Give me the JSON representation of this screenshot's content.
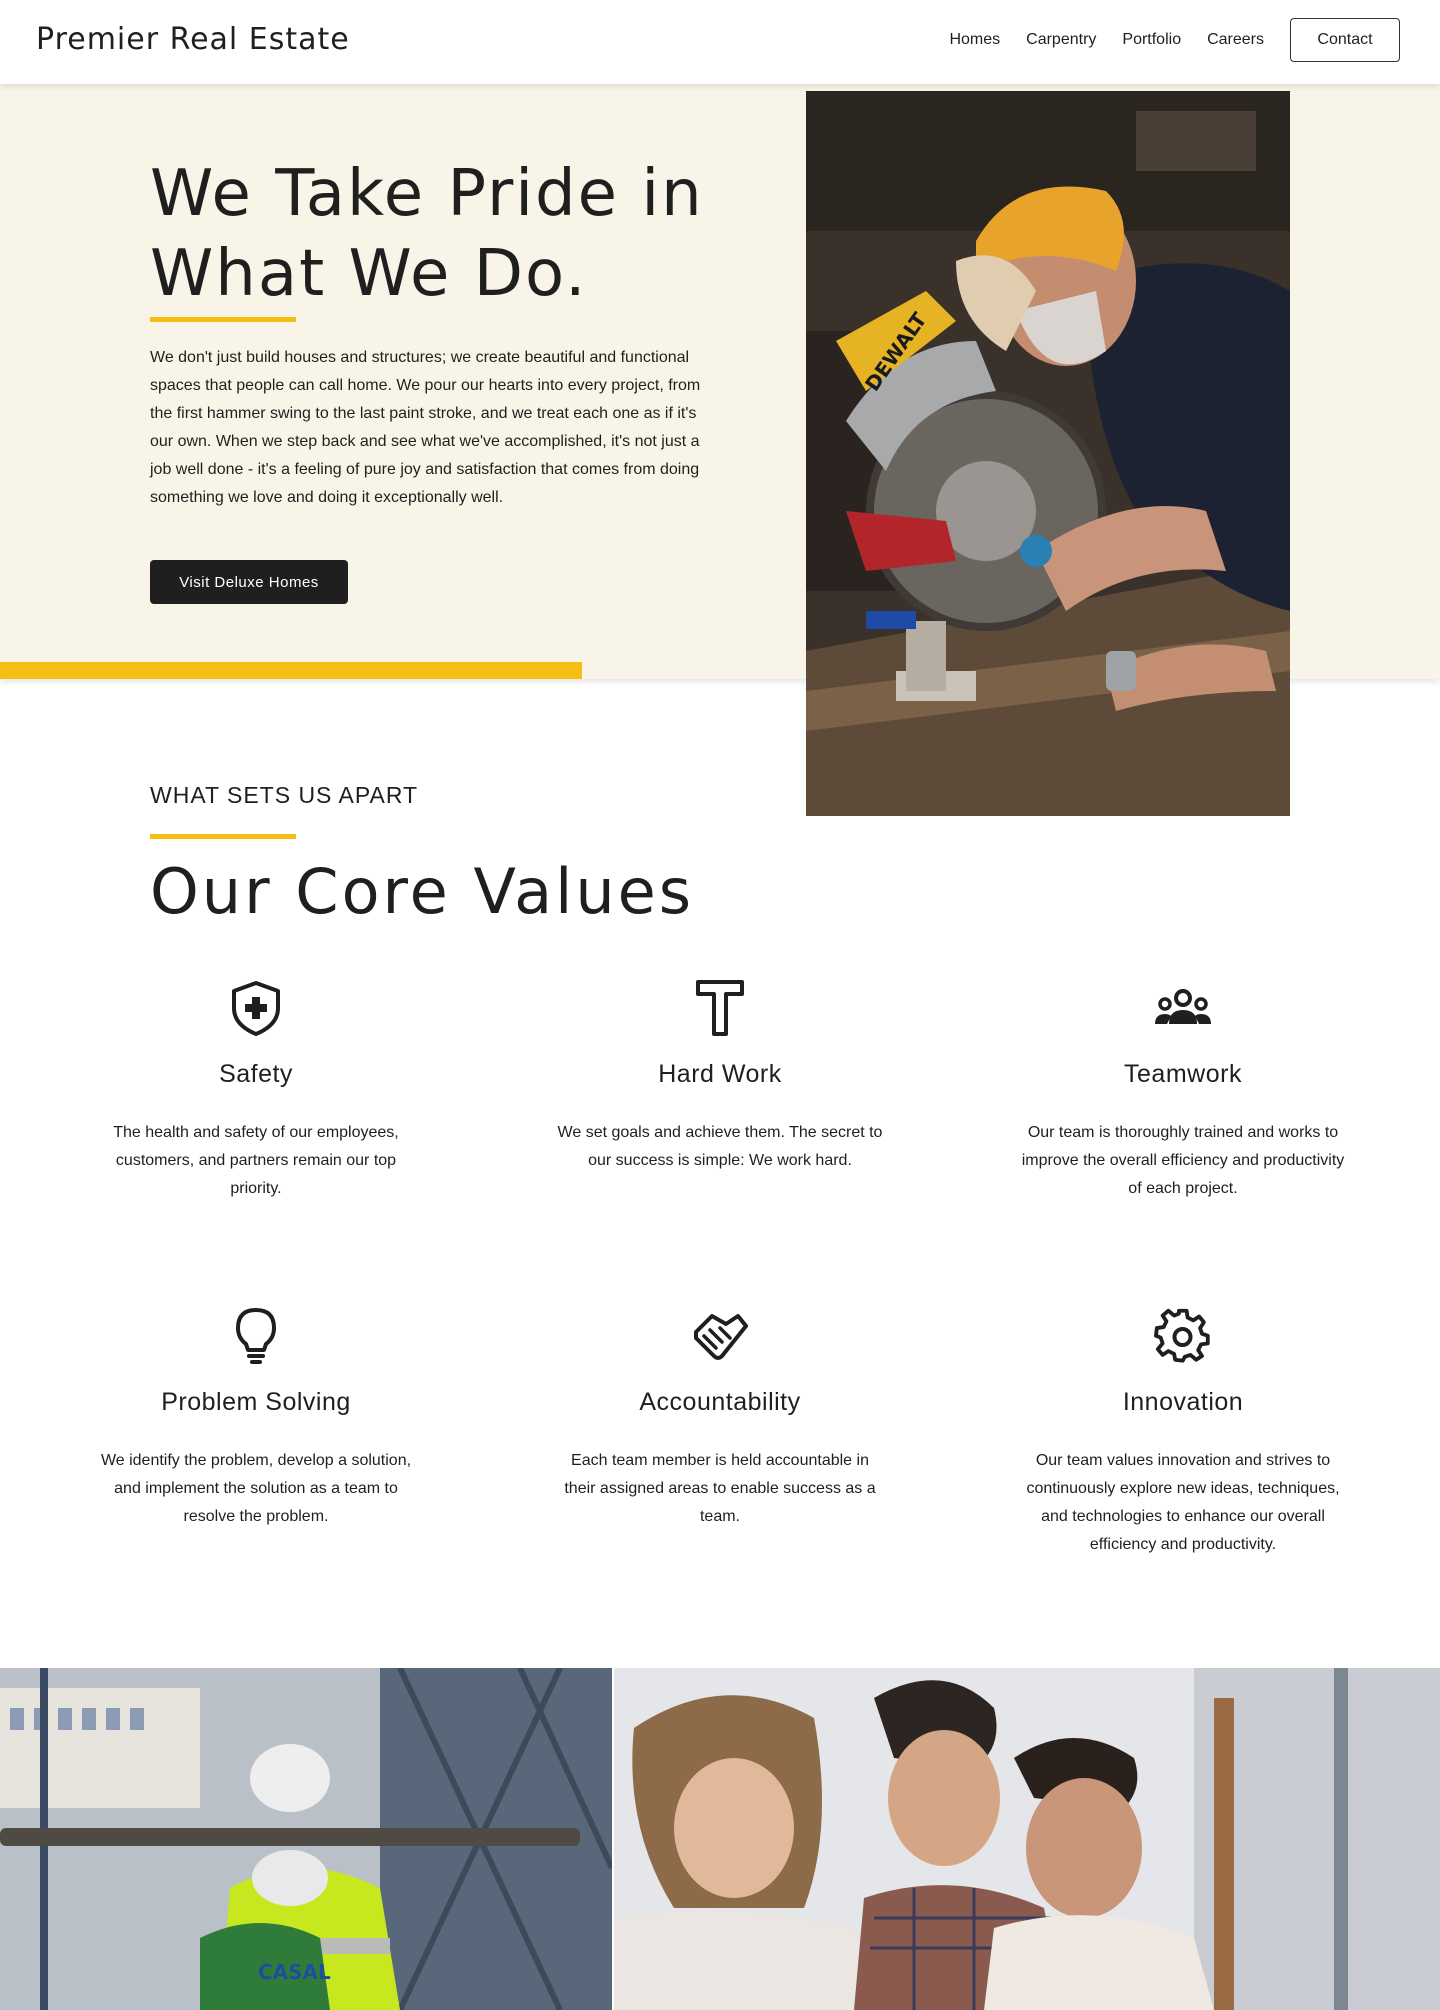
{
  "header": {
    "brand": "Premier Real Estate",
    "nav": [
      "Homes",
      "Carpentry",
      "Portfolio",
      "Careers"
    ],
    "contact_label": "Contact"
  },
  "hero": {
    "title_line1": "We Take Pride in",
    "title_line2": "What We Do.",
    "body": "We don't just build houses and structures; we create beautiful and functional spaces that people can call home. We pour our hearts into every project, from the first hammer swing to the last paint stroke, and we treat each one as if it's our own. When we step back and see what we've accomplished, it's not just a job well done - it's a feeling of pure joy and satisfaction that comes from doing something we love and doing it exceptionally well.",
    "button_label": "Visit Deluxe Homes",
    "photo_brand_text": "DEWALT"
  },
  "values_section": {
    "eyebrow": "WHAT SETS US APART",
    "title": "Our Core Values",
    "items": [
      {
        "icon": "shield-plus-icon",
        "title": "Safety",
        "desc": "The health and safety of our employees, customers, and partners remain our top priority."
      },
      {
        "icon": "hammer-icon",
        "title": "Hard Work",
        "desc": "We set goals and achieve them. The secret to our success is simple: We work hard."
      },
      {
        "icon": "team-icon",
        "title": "Teamwork",
        "desc": "Our team is thoroughly trained and works to improve the overall efficiency and productivity of each project."
      },
      {
        "icon": "lightbulb-icon",
        "title": "Problem Solving",
        "desc": "We identify the problem, develop a solution, and implement the solution as a team to resolve the problem."
      },
      {
        "icon": "handshake-icon",
        "title": "Accountability",
        "desc": "Each team member is held accountable in their assigned areas to enable success as a team."
      },
      {
        "icon": "gear-icon",
        "title": "Innovation",
        "desc": "Our team values innovation and strives to continuously explore new ideas, techniques, and technologies to enhance our overall efficiency and productivity."
      }
    ]
  },
  "bottom": {
    "vest_text": "CASAL"
  },
  "colors": {
    "accent": "#f5be12",
    "hero_bg": "#f8f5e8",
    "dark": "#1f1f1f"
  }
}
